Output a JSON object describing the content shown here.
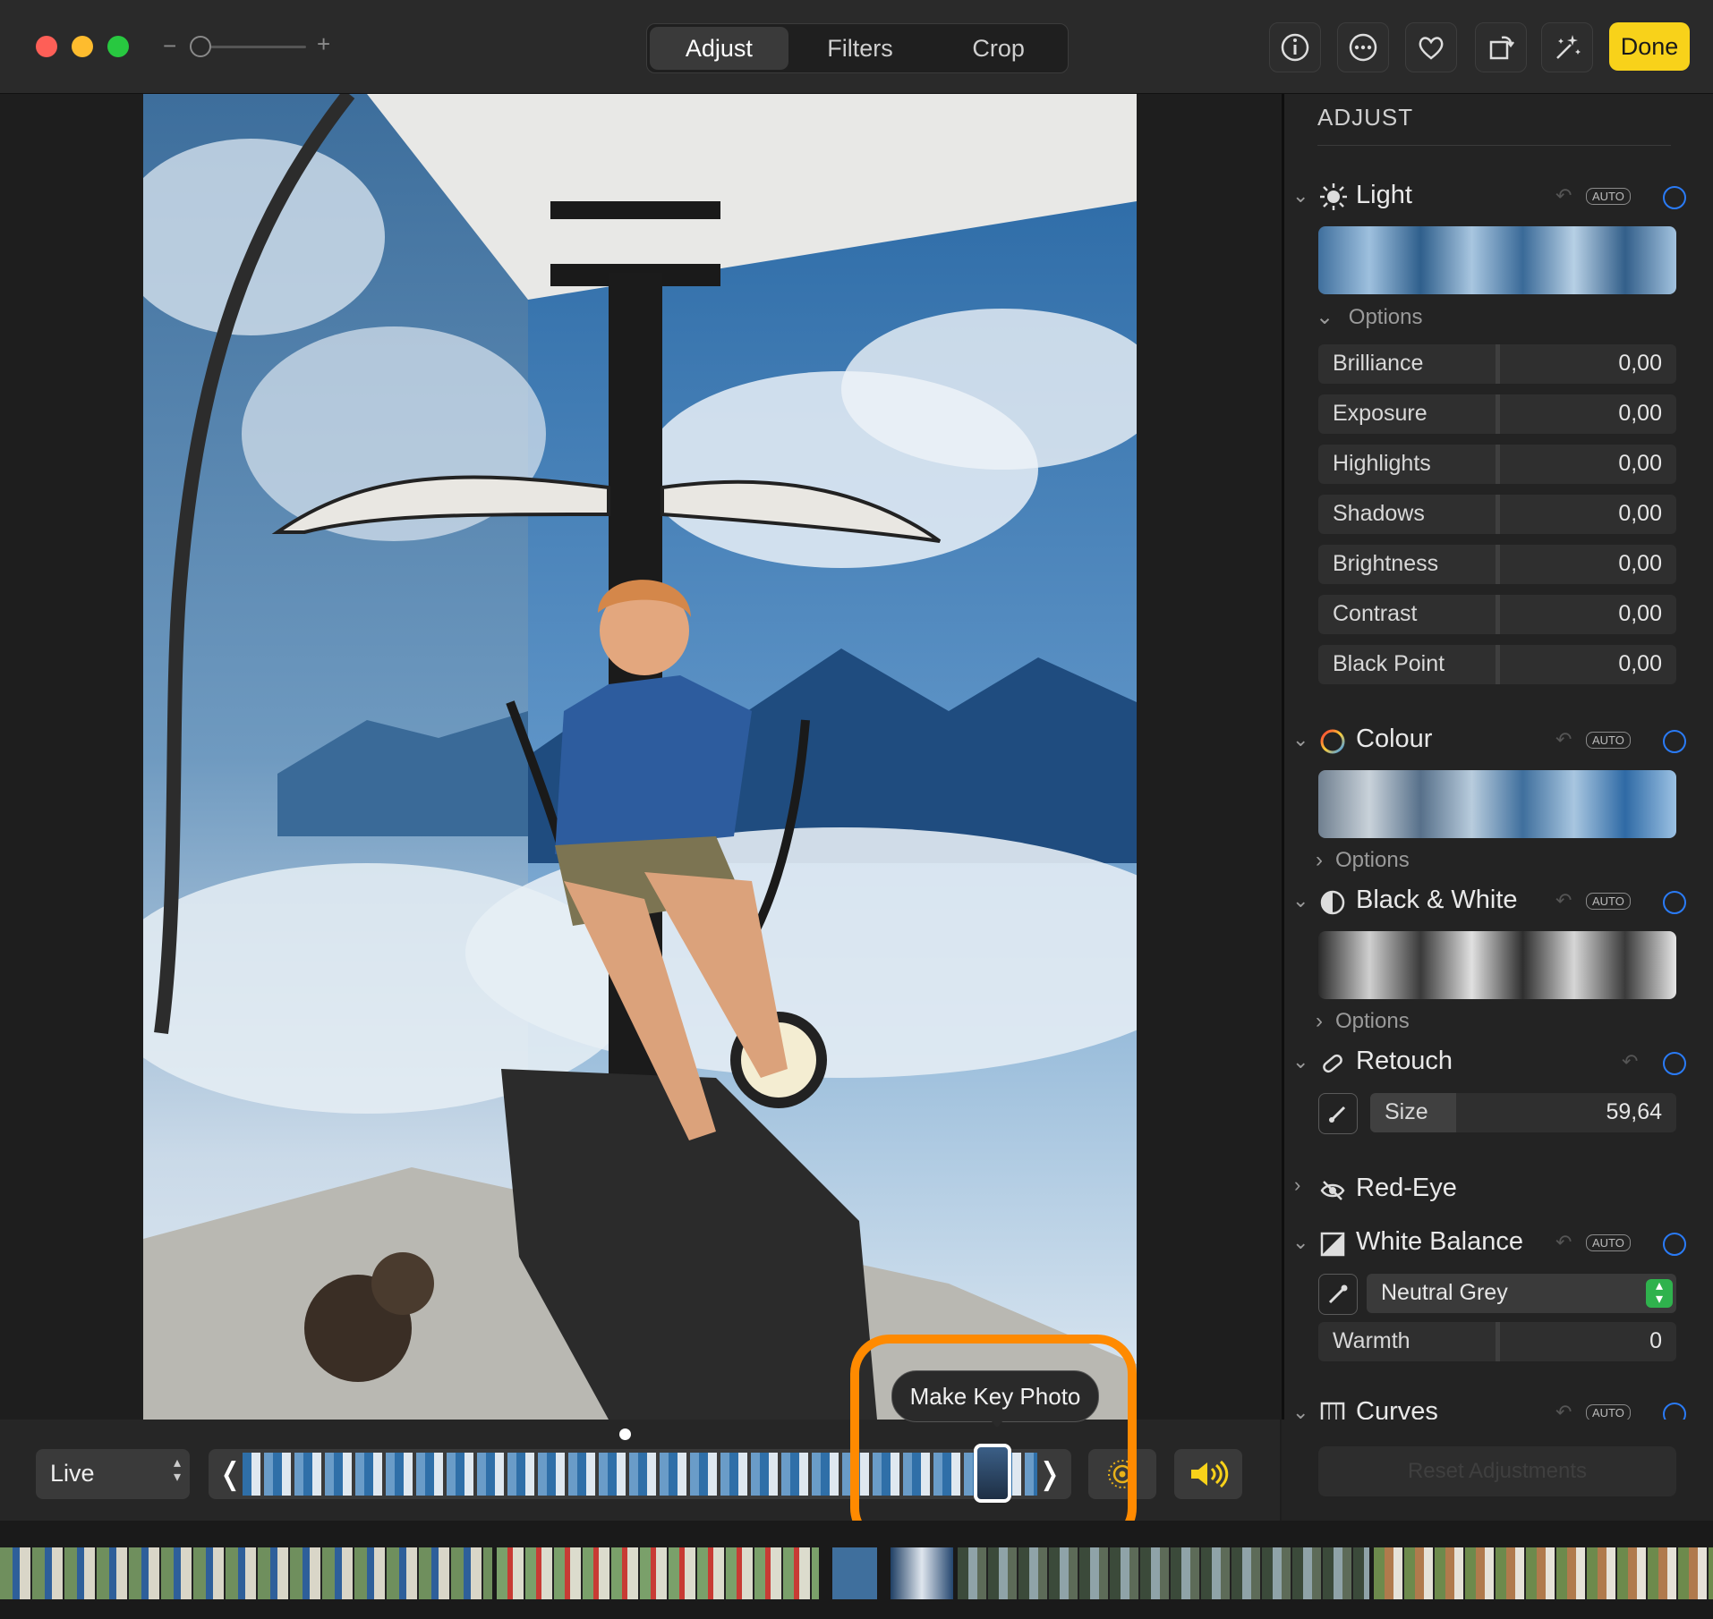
{
  "toolbar": {
    "zoom_minus": "−",
    "zoom_plus": "+",
    "tabs": [
      {
        "label": "Adjust",
        "active": true
      },
      {
        "label": "Filters",
        "active": false
      },
      {
        "label": "Crop",
        "active": false
      }
    ],
    "icons": [
      "info-icon",
      "more-icon",
      "heart-icon",
      "rotate-icon",
      "magic-wand-icon"
    ],
    "done_label": "Done"
  },
  "panel": {
    "title": "ADJUST",
    "auto_label": "AUTO",
    "light": {
      "label": "Light",
      "options_label": "Options",
      "rows": [
        {
          "label": "Brilliance",
          "value": "0,00"
        },
        {
          "label": "Exposure",
          "value": "0,00"
        },
        {
          "label": "Highlights",
          "value": "0,00"
        },
        {
          "label": "Shadows",
          "value": "0,00"
        },
        {
          "label": "Brightness",
          "value": "0,00"
        },
        {
          "label": "Contrast",
          "value": "0,00"
        },
        {
          "label": "Black Point",
          "value": "0,00"
        }
      ]
    },
    "colour": {
      "label": "Colour",
      "options_label": "Options"
    },
    "bw": {
      "label": "Black & White",
      "options_label": "Options"
    },
    "retouch": {
      "label": "Retouch",
      "size_label": "Size",
      "size_value": "59,64"
    },
    "redeye": {
      "label": "Red-Eye"
    },
    "white_balance": {
      "label": "White Balance",
      "mode": "Neutral Grey",
      "warmth_label": "Warmth",
      "warmth_value": "0"
    },
    "curves": {
      "label": "Curves"
    },
    "reset_label": "Reset Adjustments"
  },
  "bottom": {
    "live_select": "Live",
    "tooltip": "Make Key Photo"
  },
  "colors": {
    "accent_yellow": "#f8d21a",
    "accent_blue": "#2a7bf6",
    "highlight_orange": "#ff8a00"
  }
}
